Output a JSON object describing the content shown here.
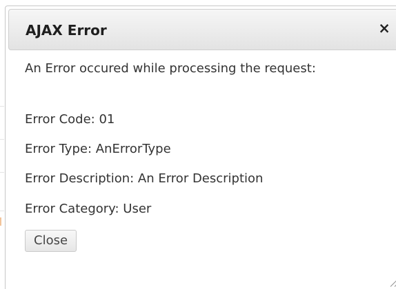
{
  "dialog": {
    "title": "AJAX Error",
    "close_icon": "×",
    "message": "An Error occured while processing the request:",
    "error_code": "Error Code: 01",
    "error_type": "Error Type: AnErrorType",
    "error_description": "Error Description: An Error Description",
    "error_category": "Error Category: User",
    "close_button_label": "Close"
  },
  "icons": {
    "close": "close-icon",
    "resize": "resize-handle-icon"
  },
  "colors": {
    "title_text": "#1e1e1e",
    "body_text": "#333333",
    "border": "#c7c7c7",
    "button_text": "#454545"
  }
}
